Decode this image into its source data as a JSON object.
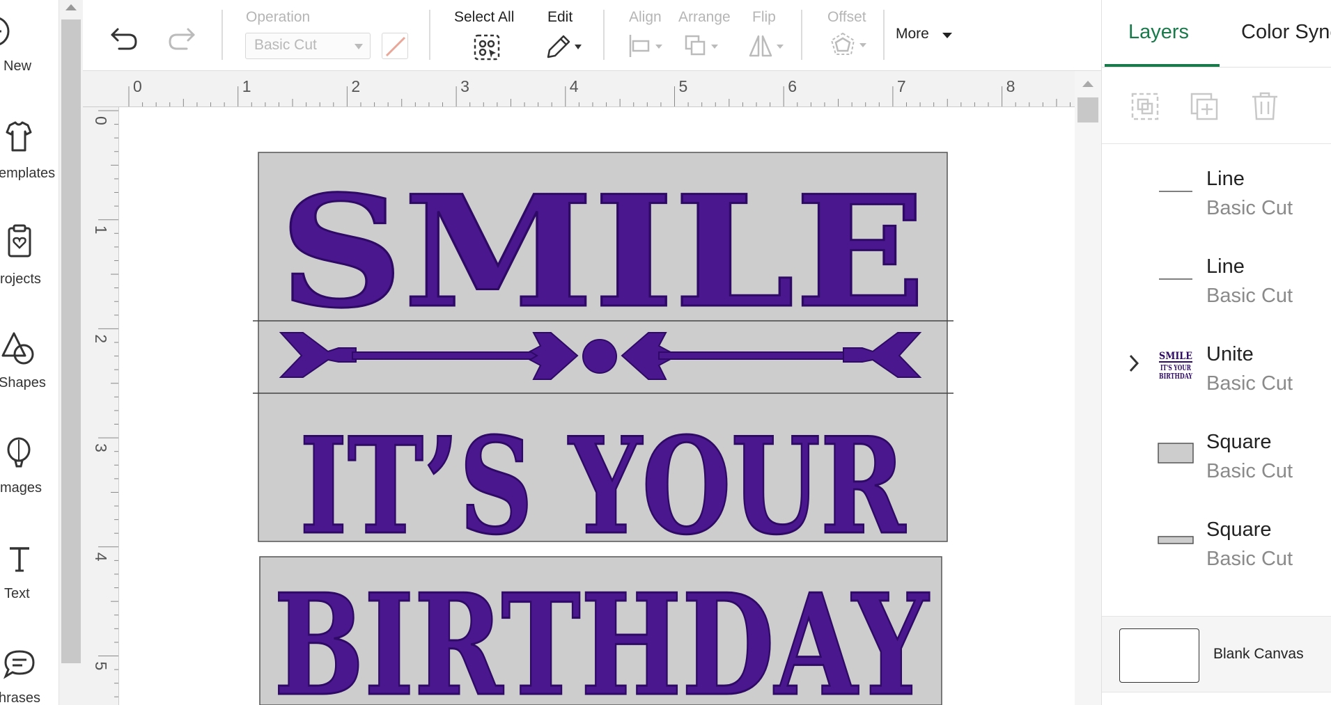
{
  "left_sidebar": {
    "items": [
      {
        "label": "New",
        "icon": "plus-circle-icon"
      },
      {
        "label": "emplates",
        "icon": "tshirt-icon"
      },
      {
        "label": "rojects",
        "icon": "clipboard-heart-icon"
      },
      {
        "label": "Shapes",
        "icon": "shapes-icon"
      },
      {
        "label": "mages",
        "icon": "lightbulb-balloon-icon"
      },
      {
        "label": "Text",
        "icon": "text-t-icon"
      },
      {
        "label": "hrases",
        "icon": "speech-bubble-icon"
      }
    ]
  },
  "toolbar": {
    "undo_icon": "undo-icon",
    "redo_icon": "redo-icon",
    "operation_label": "Operation",
    "operation_value": "Basic Cut",
    "select_all_label": "Select All",
    "edit_label": "Edit",
    "align_label": "Align",
    "arrange_label": "Arrange",
    "flip_label": "Flip",
    "offset_label": "Offset",
    "more_label": "More"
  },
  "ruler": {
    "top_numbers": [
      "0",
      "1",
      "2",
      "3",
      "4",
      "5",
      "6",
      "7",
      "8"
    ],
    "left_numbers": [
      "0",
      "1",
      "2",
      "3",
      "4",
      "5"
    ]
  },
  "design": {
    "line1": "SMILE",
    "line2": "IT’S YOUR",
    "line3": "BIRTHDAY",
    "text_color": "#4a178f",
    "box_color": "#cdcdcd"
  },
  "right_panel": {
    "tabs": [
      "Layers",
      "Color Sync"
    ],
    "active_tab": "Layers",
    "accent_color": "#1a7a4c",
    "layers": [
      {
        "name": "Line",
        "operation": "Basic Cut",
        "thumb": "line"
      },
      {
        "name": "Line",
        "operation": "Basic Cut",
        "thumb": "line"
      },
      {
        "name": "Unite",
        "operation": "Basic Cut",
        "thumb": "text",
        "expandable": true
      },
      {
        "name": "Square",
        "operation": "Basic Cut",
        "thumb": "square"
      },
      {
        "name": "Square",
        "operation": "Basic Cut",
        "thumb": "thin-square"
      }
    ],
    "thumb_text": [
      "SMILE",
      "IT'S YOUR",
      "BIRTHDAY"
    ],
    "blank_canvas_label": "Blank Canvas"
  }
}
